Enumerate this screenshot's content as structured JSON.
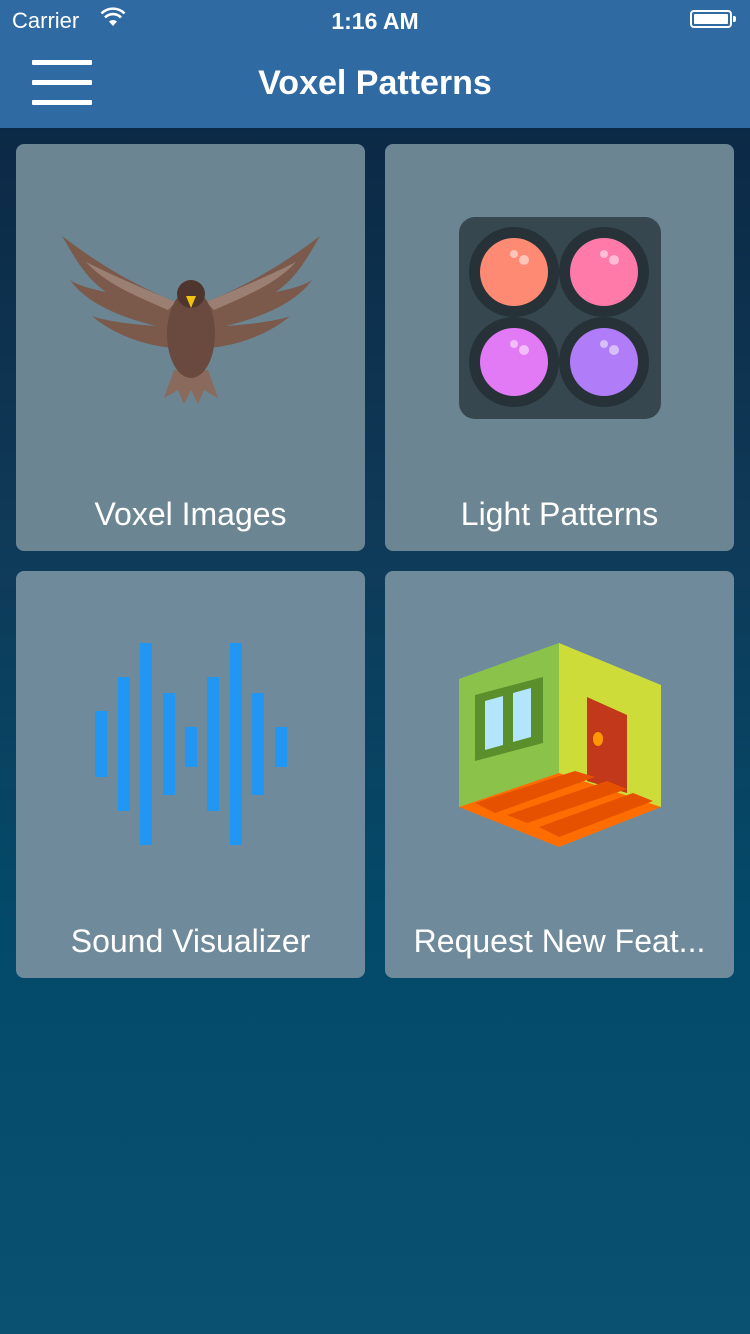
{
  "status_bar": {
    "carrier": "Carrier",
    "time": "1:16 AM"
  },
  "header": {
    "title": "Voxel Patterns",
    "menu_icon": "hamburger-icon"
  },
  "tiles": [
    {
      "label": "Voxel Images",
      "icon": "eagle-icon"
    },
    {
      "label": "Light Patterns",
      "icon": "light-pad-icon"
    },
    {
      "label": "Sound Visualizer",
      "icon": "sound-wave-icon"
    },
    {
      "label": "Request New Feat...",
      "icon": "room-icon"
    }
  ],
  "colors": {
    "header": "#2f6aa3",
    "tile": "#6c8592",
    "sound_wave": "#2196f3",
    "light_colors": [
      "#ff8a73",
      "#ff7aa8",
      "#e27af5",
      "#b07cf7"
    ]
  }
}
